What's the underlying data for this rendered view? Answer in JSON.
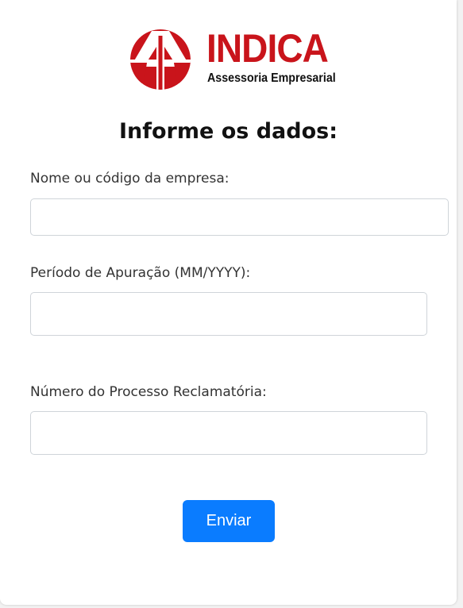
{
  "brand": {
    "name": "INDICA",
    "tagline": "Assessoria Empresarial",
    "color": "#c9141b"
  },
  "form": {
    "heading": "Informe os dados:",
    "fields": [
      {
        "label": "Nome ou código da empresa:",
        "value": "",
        "placeholder": ""
      },
      {
        "label": "Período de Apuração (MM/YYYY):",
        "value": "",
        "placeholder": ""
      },
      {
        "label": "Número do Processo Reclamatória:",
        "value": "",
        "placeholder": ""
      }
    ],
    "submit_label": "Enviar",
    "submit_color": "#0a7cff"
  }
}
